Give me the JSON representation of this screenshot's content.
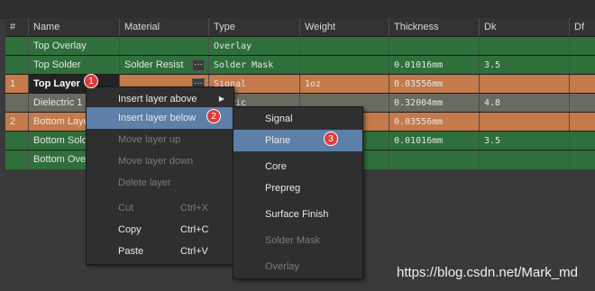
{
  "columns": [
    "#",
    "Name",
    "Material",
    "Type",
    "Weight",
    "Thickness",
    "Dk",
    "Df"
  ],
  "rows": [
    {
      "num": "",
      "name": "Top Overlay",
      "material": "",
      "type": "Overlay",
      "weight": "",
      "thickness": "",
      "dk": "",
      "df": ""
    },
    {
      "num": "",
      "name": "Top Solder",
      "material": "Solder Resist",
      "type": "Solder Mask",
      "weight": "",
      "thickness": "0.01016mm",
      "dk": "3.5",
      "df": ""
    },
    {
      "num": "1",
      "name": "Top Layer",
      "material": "",
      "type": "Signal",
      "weight": "1oz",
      "thickness": "0.03556mm",
      "dk": "",
      "df": ""
    },
    {
      "num": "",
      "name": "Dielectric 1",
      "material": "",
      "type": "ectric",
      "weight": "",
      "thickness": "0.32004mm",
      "dk": "4.8",
      "df": ""
    },
    {
      "num": "2",
      "name": "Bottom Laye",
      "material": "",
      "type": "",
      "weight": "",
      "thickness": "0.03556mm",
      "dk": "",
      "df": ""
    },
    {
      "num": "",
      "name": "Bottom Sold",
      "material": "",
      "type": "",
      "weight": "",
      "thickness": "0.01016mm",
      "dk": "3.5",
      "df": ""
    },
    {
      "num": "",
      "name": "Bottom Ove",
      "material": "",
      "type": "",
      "weight": "",
      "thickness": "",
      "dk": "",
      "df": ""
    }
  ],
  "more_button": "···",
  "context_menu": {
    "insert_above": "Insert layer above",
    "insert_below": "Insert layer below",
    "move_up": "Move layer up",
    "move_down": "Move layer down",
    "delete": "Delete layer",
    "cut": "Cut",
    "cut_shortcut": "Ctrl+X",
    "copy": "Copy",
    "copy_shortcut": "Ctrl+C",
    "paste": "Paste",
    "paste_shortcut": "Ctrl+V"
  },
  "submenu": {
    "signal": "Signal",
    "plane": "Plane",
    "core": "Core",
    "prepreg": "Prepreg",
    "surface_finish": "Surface Finish",
    "solder_mask": "Solder Mask",
    "overlay": "Overlay"
  },
  "badges": [
    "1",
    "2",
    "3"
  ],
  "watermark": "https://blog.csdn.net/Mark_md",
  "colors": {
    "signal_row": "#c47a4a",
    "overlay_row": "#2f6f3b",
    "highlight": "#5d7fa8",
    "badge": "#e03b3b"
  }
}
